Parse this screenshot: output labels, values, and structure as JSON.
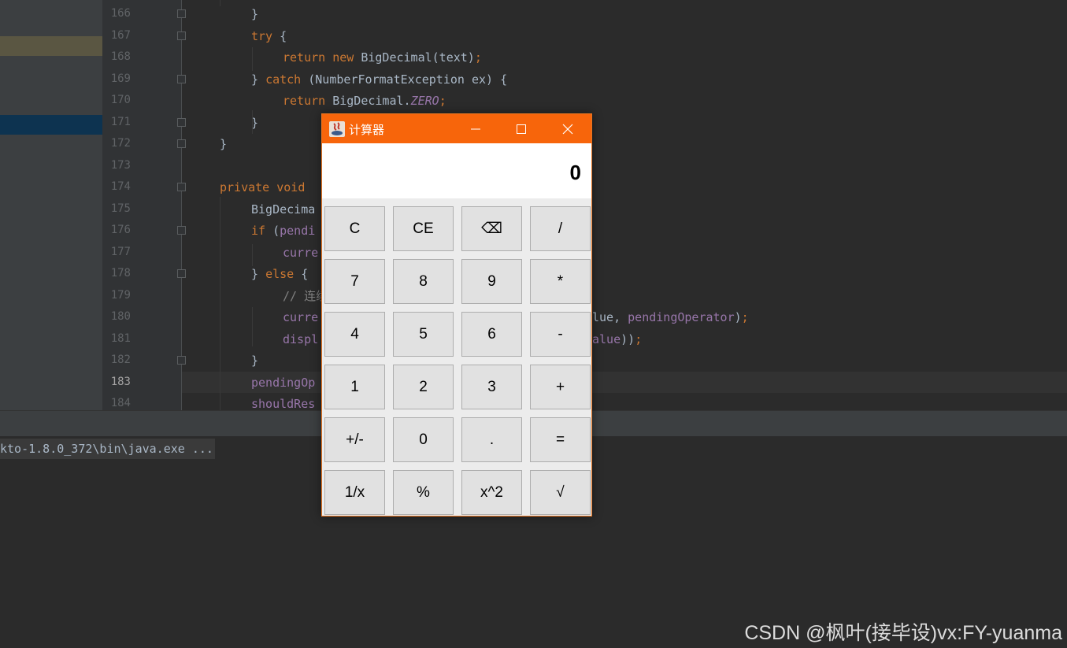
{
  "editor": {
    "line_numbers": [
      "166",
      "167",
      "168",
      "169",
      "170",
      "171",
      "172",
      "173",
      "174",
      "175",
      "176",
      "177",
      "178",
      "179",
      "180",
      "181",
      "182",
      "183",
      "184"
    ],
    "current_line": "183",
    "lines": [
      [
        {
          "t": "}",
          "c": "p"
        }
      ],
      [
        {
          "t": "try",
          "c": "kw"
        },
        {
          "t": " {",
          "c": "p"
        }
      ],
      [
        {
          "t": "return new",
          "c": "kw"
        },
        {
          "t": " BigDecimal(text)",
          "c": "p"
        },
        {
          "t": ";",
          "c": "punc"
        }
      ],
      [
        {
          "t": "} ",
          "c": "p"
        },
        {
          "t": "catch",
          "c": "kw"
        },
        {
          "t": " (NumberFormatException ex) {",
          "c": "p"
        }
      ],
      [
        {
          "t": "return",
          "c": "kw"
        },
        {
          "t": " BigDecimal.",
          "c": "p"
        },
        {
          "t": "ZERO",
          "c": "const"
        },
        {
          "t": ";",
          "c": "punc"
        }
      ],
      [
        {
          "t": "}",
          "c": "p"
        }
      ],
      [
        {
          "t": "}",
          "c": "p"
        }
      ],
      [],
      [
        {
          "t": "private void",
          "c": "kw"
        }
      ],
      [
        {
          "t": "BigDecima",
          "c": "p"
        }
      ],
      [
        {
          "t": "if",
          "c": "kw"
        },
        {
          "t": " (",
          "c": "p"
        },
        {
          "t": "pendi",
          "c": "fld"
        }
      ],
      [
        {
          "t": "curre",
          "c": "fld"
        }
      ],
      [
        {
          "t": "} ",
          "c": "p"
        },
        {
          "t": "else",
          "c": "kw"
        },
        {
          "t": " {",
          "c": "p"
        }
      ],
      [
        {
          "t": "// 连续",
          "c": "cmt"
        }
      ],
      [
        {
          "t": "curre",
          "c": "fld"
        }
      ],
      [
        {
          "t": "displ",
          "c": "fld"
        }
      ],
      [
        {
          "t": "}",
          "c": "p"
        }
      ],
      [
        {
          "t": "pendingOp",
          "c": "fld"
        }
      ],
      [
        {
          "t": "shouldRes",
          "c": "fld"
        }
      ]
    ],
    "right_fragments": {
      "line_180": [
        {
          "t": "lue, ",
          "c": "p"
        },
        {
          "t": "pendingOperator",
          "c": "fld"
        },
        {
          "t": ")",
          "c": "p"
        },
        {
          "t": ";",
          "c": "punc"
        }
      ],
      "line_181": [
        {
          "t": "alue",
          "c": "fld"
        },
        {
          "t": "))",
          "c": "p"
        },
        {
          "t": ";",
          "c": "punc"
        }
      ]
    }
  },
  "console": {
    "run_command": "kto-1.8.0_372\\bin\\java.exe ..."
  },
  "calculator": {
    "title": "计算器",
    "display_value": "0",
    "keys": [
      "C",
      "CE",
      "⌫",
      "/",
      "7",
      "8",
      "9",
      "*",
      "4",
      "5",
      "6",
      "-",
      "1",
      "2",
      "3",
      "+",
      "+/-",
      "0",
      ".",
      "=",
      "1/x",
      "%",
      "x^2",
      "√"
    ],
    "title_bar_color": "#f7650b"
  },
  "watermark": "CSDN @枫叶(接毕设)vx:FY-yuanma"
}
